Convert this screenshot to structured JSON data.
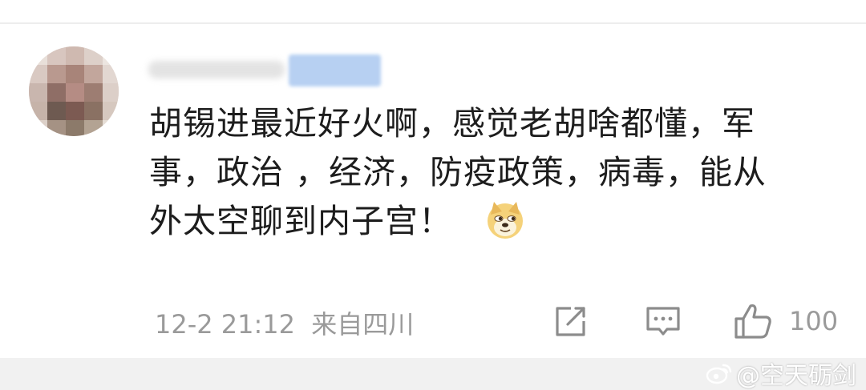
{
  "comment": {
    "text_line1": "胡锡进最近好火啊，感觉老胡啥都懂，军",
    "text_line2": "事，政治 ，经济，防疫政策，病毒，能从",
    "text_line3": "外太空聊到内子宫！",
    "emoji": "doge-emoji",
    "timestamp": "12-2 21:12",
    "location": "来自四川"
  },
  "actions": {
    "share_icon": "share-icon",
    "comment_icon": "comment-icon",
    "like_icon": "thumbs-up-icon",
    "like_count": "100"
  },
  "watermark": {
    "text": "@空天砺剑"
  },
  "colors": {
    "text": "#1d1d1d",
    "meta": "#9a9a9a",
    "blurred_name_highlight": "#b7d0f2"
  }
}
